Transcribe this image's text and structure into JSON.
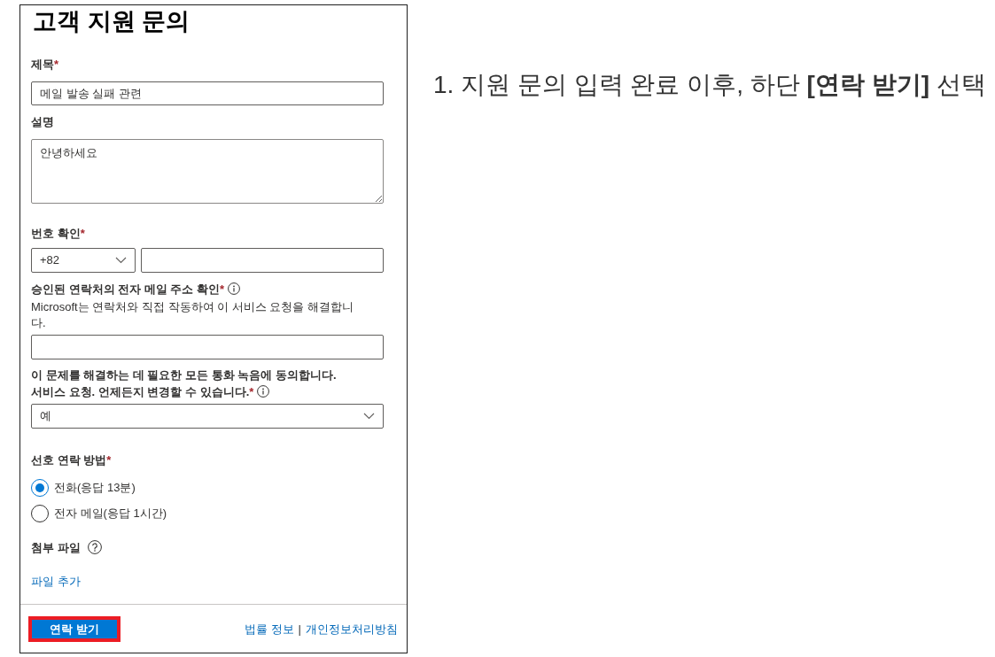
{
  "form": {
    "title": "고객 지원 문의",
    "fields": [
      {
        "kind": "text",
        "label": "제목",
        "required_mark": "*",
        "value": "메일 발송 실패 관련"
      },
      {
        "kind": "textarea",
        "label": "설명",
        "value": "안녕하세요"
      },
      {
        "kind": "phone",
        "label": "번호 확인",
        "required_mark": "*",
        "country_code": "+82"
      },
      {
        "kind": "text",
        "label": "승인된 연락처의 전자 메일 주소 확인",
        "required_mark": "*",
        "info_icon": true,
        "description": "Microsoft는 연락처와 직접 작동하여 이 서비스 요청을 해결합니다."
      },
      {
        "kind": "select",
        "label_lines": [
          "이 문제를 해결하는 데 필요한 모든 통화 녹음에 동의합니다.",
          "서비스 요청. 언제든지 변경할 수 있습니다."
        ],
        "required_mark": "*",
        "info_icon": true,
        "value": "예"
      },
      {
        "kind": "radio_group",
        "label": "선호 연락 방법",
        "required_mark": "*",
        "options": [
          {
            "label": "전화(응답 13분)",
            "selected": true
          },
          {
            "label": "전자 메일(응답 1시간)",
            "selected": false
          }
        ]
      },
      {
        "kind": "attachment",
        "label": "첨부 파일",
        "help_icon": true,
        "link": "파일 추가"
      }
    ]
  },
  "footer": {
    "submit_button": {
      "label": "연락 받기",
      "highlighted": true
    },
    "links": [
      "법률 정보",
      "개인정보처리방침"
    ],
    "separator": "|"
  },
  "instruction": "1. 지원 문의 입력 완료 이후, 하단 **[연락 받기]** 선택"
}
